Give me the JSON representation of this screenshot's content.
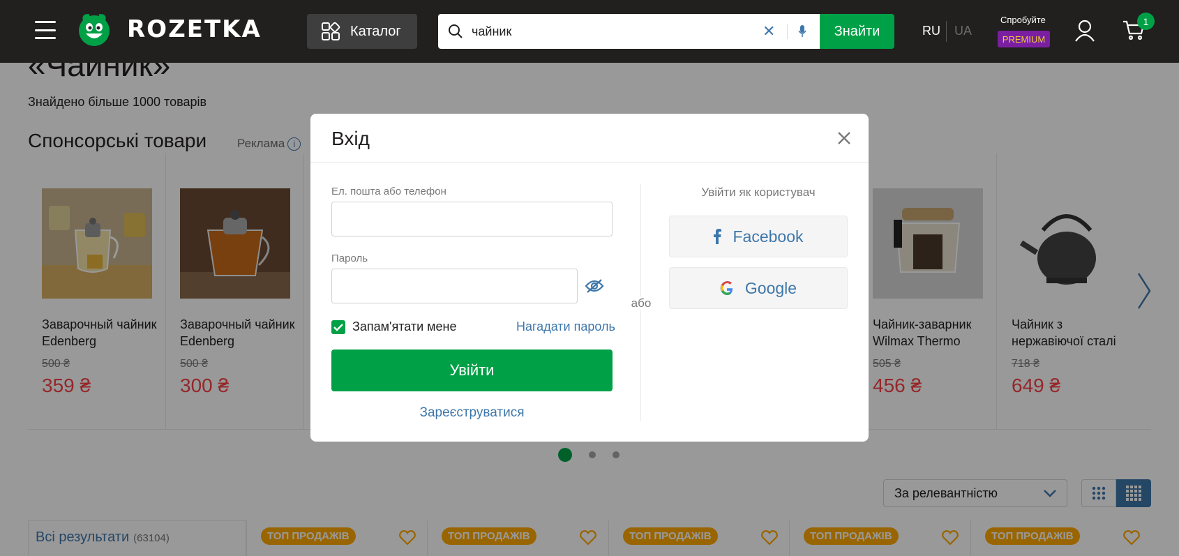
{
  "header": {
    "logo_text": "ROZETKA",
    "catalog_label": "Каталог",
    "search_value": "чайник",
    "search_button": "Знайти",
    "lang_ru": "RU",
    "lang_ua": "UA",
    "premium_try": "Спробуйте",
    "premium_badge": "PREMIUM",
    "cart_count": "1"
  },
  "page": {
    "query_title": "«Чайник»",
    "found_text": "Знайдено більше 1000 товарів",
    "sponsored_title": "Спонсорські товари",
    "ad_label": "Реклама",
    "info_glyph": "i"
  },
  "sponsored_products": [
    {
      "title": "Заварочный чайник Edenberg",
      "old_price": "500 ₴",
      "price": "359 ₴"
    },
    {
      "title": "Заварочный чайник Edenberg",
      "old_price": "500 ₴",
      "price": "300 ₴"
    },
    {
      "title": "Чайник-заварник Wilmax Thermo",
      "old_price": "505 ₴",
      "price": "456 ₴"
    },
    {
      "title": "Чайник з нержавіючої сталі",
      "old_price": "718 ₴",
      "price": "649 ₴"
    }
  ],
  "sort": {
    "selected": "За релевантністю"
  },
  "results": {
    "all_label": "Всі результати",
    "all_count": "(63104)",
    "top_labels": [
      "ТОП ПРОДАЖІВ",
      "ТОП ПРОДАЖІВ",
      "ТОП ПРОДАЖІВ",
      "ТОП ПРОДАЖІВ",
      "ТОП ПРОДАЖІВ"
    ]
  },
  "modal": {
    "title": "Вхід",
    "email_label": "Ел. пошта або телефон",
    "email_value": "",
    "password_label": "Пароль",
    "password_value": "",
    "remember_label": "Запам'ятати мене",
    "remember_checked": true,
    "forgot_link": "Нагадати пароль",
    "login_button": "Увійти",
    "register_link": "Зареєструватися",
    "or_label": "або",
    "social_title": "Увійти як користувач",
    "facebook_label": "Facebook",
    "google_label": "Google"
  },
  "colors": {
    "brand_green": "#00a046",
    "header_bg": "#221f1f",
    "link_blue": "#3e77aa",
    "price_red": "#f84147",
    "top_badge": "#ffa900",
    "premium_bg": "#7b1fa2"
  }
}
